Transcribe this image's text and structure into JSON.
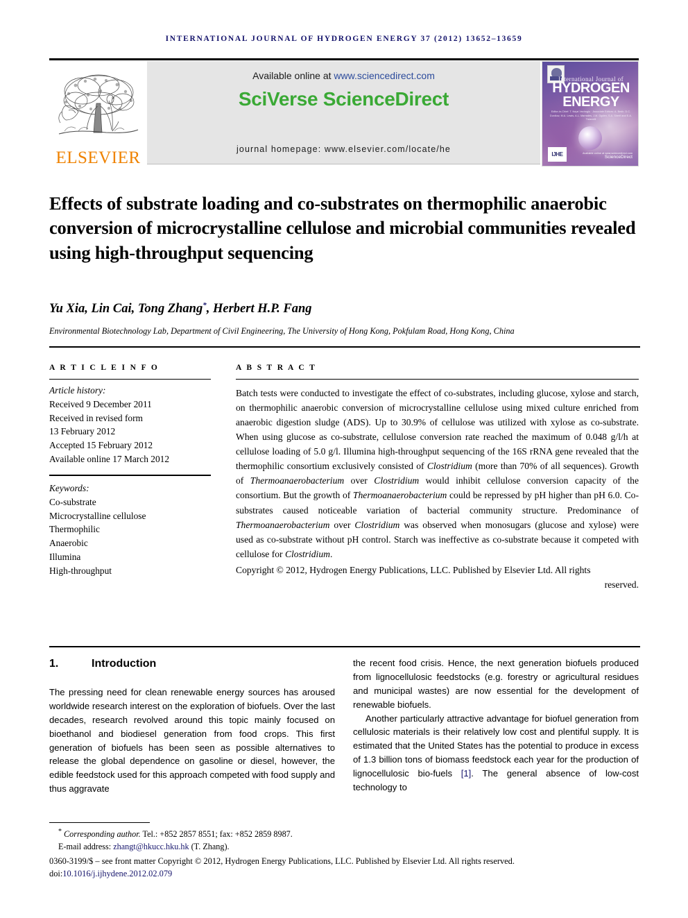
{
  "running_head": "INTERNATIONAL JOURNAL OF HYDROGEN ENERGY 37 (2012) 13652–13659",
  "masthead": {
    "publisher_name": "ELSEVIER",
    "available_prefix": "Available online at ",
    "available_url": "www.sciencedirect.com",
    "sciencedirect_logo": "SciVerse ScienceDirect",
    "journal_homepage": "journal homepage: www.elsevier.com/locate/he",
    "cover": {
      "line1": "International Journal of",
      "word1": "HYDROGEN",
      "word2": "ENERGY",
      "editors": "Editor-in-Chief:  T. Nejat Veziroglu · Associate Editors: A. Bedir, D.C. Dunikov, M.A. Lewis, A.L. Marrades, J.M. Ogden, S.A. Sherif and E.A. Ticianelli",
      "ijhe_mark": "IJHE",
      "sd_mark": "ScienceDirect",
      "sd_tiny": "Available online at www.sciencedirect.com"
    }
  },
  "article": {
    "title": "Effects of substrate loading and co-substrates on thermophilic anaerobic conversion of microcrystalline cellulose and microbial communities revealed using high-throughput sequencing",
    "authors": "Yu Xia, Lin Cai, Tong Zhang",
    "author_star": "*",
    "authors_tail": ", Herbert H.P. Fang",
    "affiliation": "Environmental Biotechnology Lab, Department of Civil Engineering, The University of Hong Kong, Pokfulam Road, Hong Kong, China"
  },
  "article_info": {
    "heading": "A R T I C L E   I N F O",
    "history_label": "Article history:",
    "lines": [
      "Received 9 December 2011",
      "Received in revised form",
      "13 February 2012",
      "Accepted 15 February 2012",
      "Available online 17 March 2012"
    ],
    "keywords_label": "Keywords:",
    "keywords": [
      "Co-substrate",
      "Microcrystalline cellulose",
      "Thermophilic",
      "Anaerobic",
      "Illumina",
      "High-throughput"
    ]
  },
  "abstract": {
    "heading": "A B S T R A C T",
    "part1": "Batch tests were conducted to investigate the effect of co-substrates, including glucose, xylose and starch, on thermophilic anaerobic conversion of microcrystalline cellulose using mixed culture enriched from anaerobic digestion sludge (ADS). Up to 30.9% of cellulose was utilized with xylose as co-substrate. When using glucose as co-substrate, cellulose conversion rate reached the maximum of 0.048 g/l/h at cellulose loading of 5.0 g/l. Illumina high-throughput sequencing of the 16S rRNA gene revealed that the thermophilic consortium exclusively consisted of ",
    "italic1": "Clostridium",
    "part2": " (more than 70% of all sequences). Growth of ",
    "italic2": "Thermoanaerobacterium",
    "part3": " over ",
    "italic3": "Clostridium",
    "part4": " would inhibit cellulose conversion capacity of the consortium. But the growth of ",
    "italic4": "Thermoanaerobacterium",
    "part5": " could be repressed by pH higher than pH 6.0. Co-substrates caused noticeable variation of bacterial community structure. Predominance of ",
    "italic5": "Thermoanaerobacterium",
    "part6": " over ",
    "italic6": "Clostridium",
    "part7": " was observed when monosugars (glucose and xylose) were used as co-substrate without pH control. Starch was ineffective as co-substrate because it competed with cellulose for ",
    "italic7": "Clostridium",
    "part8": ".",
    "copyright": "Copyright © 2012, Hydrogen Energy Publications, LLC. Published by Elsevier Ltd. All rights",
    "copyright_last": "reserved."
  },
  "introduction": {
    "number": "1.",
    "title": "Introduction",
    "left_p1": "The pressing need for clean renewable energy sources has aroused worldwide research interest on the exploration of biofuels. Over the last decades, research revolved around this topic mainly focused on bioethanol and biodiesel generation from food crops. This first generation of biofuels has been seen as possible alternatives to release the global dependence on gasoline or diesel, however, the edible feedstock used for this approach competed with food supply and thus aggravate",
    "right_p1": "the recent food crisis. Hence, the next generation biofuels produced from lignocellulosic feedstocks (e.g. forestry or agricultural residues and municipal wastes) are now essential for the development of renewable biofuels.",
    "right_p2_a": "Another particularly attractive advantage for biofuel generation from cellulosic materials is their relatively low cost and plentiful supply. It is estimated that the United States has the potential to produce in excess of 1.3 billion tons of biomass feedstock each year for the production of lignocellulosic bio-fuels ",
    "right_p2_ref": "[1]",
    "right_p2_b": ". The general absence of low-cost technology to"
  },
  "footnotes": {
    "star": "*",
    "corresponding_label": "Corresponding author.",
    "corresponding_rest": " Tel.: +852 2857 8551; fax: +852 2859 8987.",
    "email_label": "E-mail address: ",
    "email": "zhangt@hkucc.hku.hk",
    "email_owner": " (T. Zhang).",
    "frontmatter": "0360-3199/$ – see front matter Copyright © 2012, Hydrogen Energy Publications, LLC. Published by Elsevier Ltd. All rights reserved.",
    "doi_label": "doi:",
    "doi": "10.1016/j.ijhydene.2012.02.079"
  },
  "colors": {
    "running_head": "#14136b",
    "elsevier_orange": "#ef8200",
    "sciencedirect_green": "#3aa935",
    "link_blue": "#2b4a9b",
    "ref_navy": "#14136b"
  }
}
